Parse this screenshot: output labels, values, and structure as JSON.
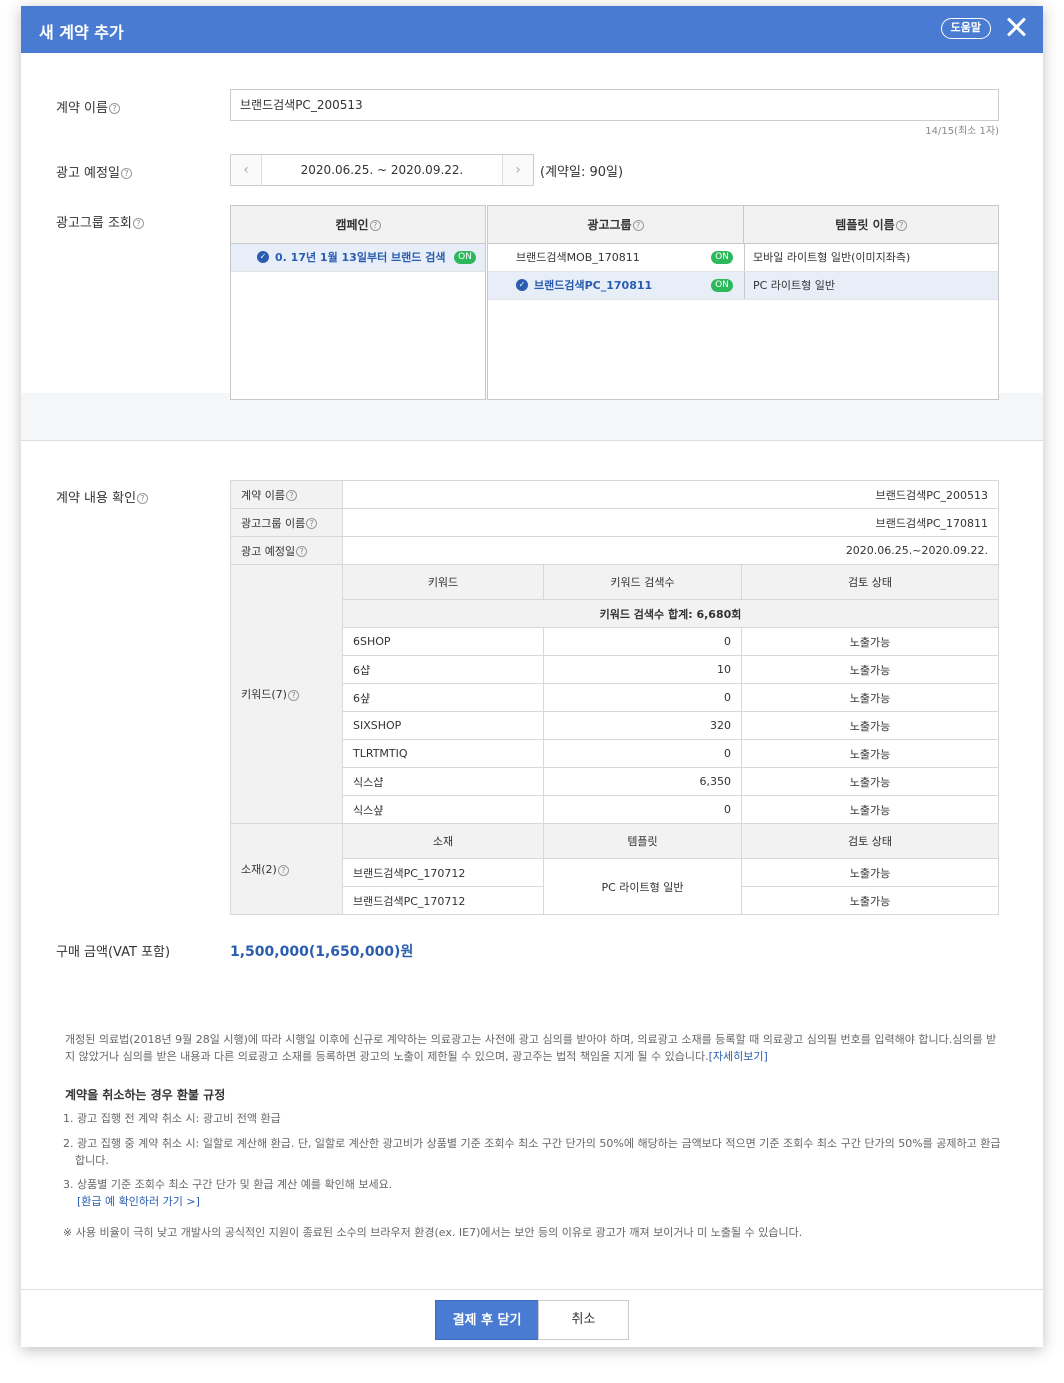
{
  "header": {
    "title": "새 계약 추가",
    "help_label": "도움말"
  },
  "form": {
    "name_label": "계약 이름",
    "name_value": "브랜드검색PC_200513",
    "name_counter": "14/15(최소 1자)",
    "date_label": "광고 예정일",
    "date_value": "2020.06.25. ~ 2020.09.22.",
    "date_note": "(계약일: 90일)",
    "group_label": "광고그룹 조회"
  },
  "campaign_panel": {
    "header": "캠페인",
    "items": [
      {
        "label": "0. 17년 1월 13일부터 브랜드 검색",
        "status": "ON",
        "selected": true
      }
    ]
  },
  "group_panel": {
    "headers": [
      "광고그룹",
      "템플릿 이름"
    ],
    "rows": [
      {
        "group": "브랜드검색MOB_170811",
        "status": "ON",
        "template": "모바일 라이트형 일반(이미지좌측)",
        "selected": false
      },
      {
        "group": "브랜드검색PC_170811",
        "status": "ON",
        "template": "PC 라이트형 일반",
        "selected": true
      }
    ]
  },
  "summary": {
    "section_label": "계약 내용 확인",
    "contract_name_label": "계약 이름",
    "contract_name": "브랜드검색PC_200513",
    "group_name_label": "광고그룹 이름",
    "group_name": "브랜드검색PC_170811",
    "date_label": "광고 예정일",
    "date": "2020.06.25.~2020.09.22.",
    "keywords_label": "키워드(7)",
    "keyword_headers": [
      "키워드",
      "키워드 검색수",
      "검토 상태"
    ],
    "keyword_total": "키워드 검색수 합계: 6,680회",
    "keywords": [
      {
        "kw": "6SHOP",
        "count": "0",
        "status": "노출가능"
      },
      {
        "kw": "6샵",
        "count": "10",
        "status": "노출가능"
      },
      {
        "kw": "6샾",
        "count": "0",
        "status": "노출가능"
      },
      {
        "kw": "SIXSHOP",
        "count": "320",
        "status": "노출가능"
      },
      {
        "kw": "TLRTMTIQ",
        "count": "0",
        "status": "노출가능"
      },
      {
        "kw": "식스샵",
        "count": "6,350",
        "status": "노출가능"
      },
      {
        "kw": "식스샾",
        "count": "0",
        "status": "노출가능"
      }
    ],
    "creatives_label": "소재(2)",
    "creative_headers": [
      "소재",
      "템플릿",
      "검토 상태"
    ],
    "creative_template": "PC 라이트형 일반",
    "creatives": [
      {
        "name": "브랜드검색PC_170712",
        "status": "노출가능"
      },
      {
        "name": "브랜드검색PC_170712",
        "status": "노출가능"
      }
    ]
  },
  "price": {
    "label": "구매 금액(VAT 포함)",
    "value": "1,500,000(1,650,000)원"
  },
  "notice": {
    "text": "개정된 의료법(2018년 9월 28일 시행)에 따라 시행일 이후에 신규로 계약하는 의료광고는 사전에 광고 심의를 받아야 하며, 의료광고 소재를 등록할 때 의료광고 심의필 번호를 입력해야 합니다.심의를 받지 않았거나 심의를 받은 내용과 다른 의료광고 소재를 등록하면 광고의 노출이 제한될 수 있으며, 광고주는 법적 책임을 지게 될 수 있습니다.",
    "link": "[자세히보기]"
  },
  "refund": {
    "title": "계약을 취소하는 경우 환불 규정",
    "item1": "1. 광고 집행 전 계약 취소 시: 광고비 전액 환급",
    "item2": "2. 광고 집행 중 계약 취소 시: 일할로 계산해 환급. 단, 일할로 계산한 광고비가 상품별 기준 조회수 최소 구간 단가의 50%에 해당하는 금액보다 적으면 기준 조회수 최소 구간 단가의 50%를 공제하고 환급합니다.",
    "item3": "3. 상품별 기준 조회수 최소 구간 단가 및 환급 계산 예를 확인해 보세요.",
    "item3_link": "[환급 예 확인하러 가기 >]",
    "footnote": "※  사용 비율이 극히 낮고 개발사의 공식적인 지원이 종료된 소수의 브라우저 환경(ex. IE7)에서는 보안 등의 이유로 광고가 깨져 보이거나 미 노출될 수 있습니다."
  },
  "footer": {
    "confirm_label": "결제 후 닫기",
    "cancel_label": "취소"
  },
  "colors": {
    "accent": "#4a7bd2",
    "on_badge": "#2eb85c",
    "link": "#2a5db0"
  }
}
